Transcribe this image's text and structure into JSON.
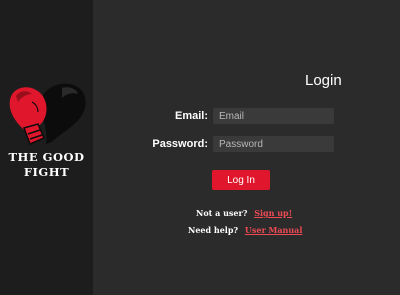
{
  "brand": {
    "line1": "THE GOOD",
    "line2": "FIGHT",
    "logo_icon": "boxing-glove-heart-icon",
    "accent": "#e0172c"
  },
  "login": {
    "title": "Login",
    "email_label": "Email:",
    "email_placeholder": "Email",
    "password_label": "Password:",
    "password_placeholder": "Password",
    "submit_label": "Log In"
  },
  "footer": {
    "signup_prompt": "Not a user?",
    "signup_link": "Sign up!",
    "help_prompt": "Need help?",
    "help_link": "User Manual"
  }
}
